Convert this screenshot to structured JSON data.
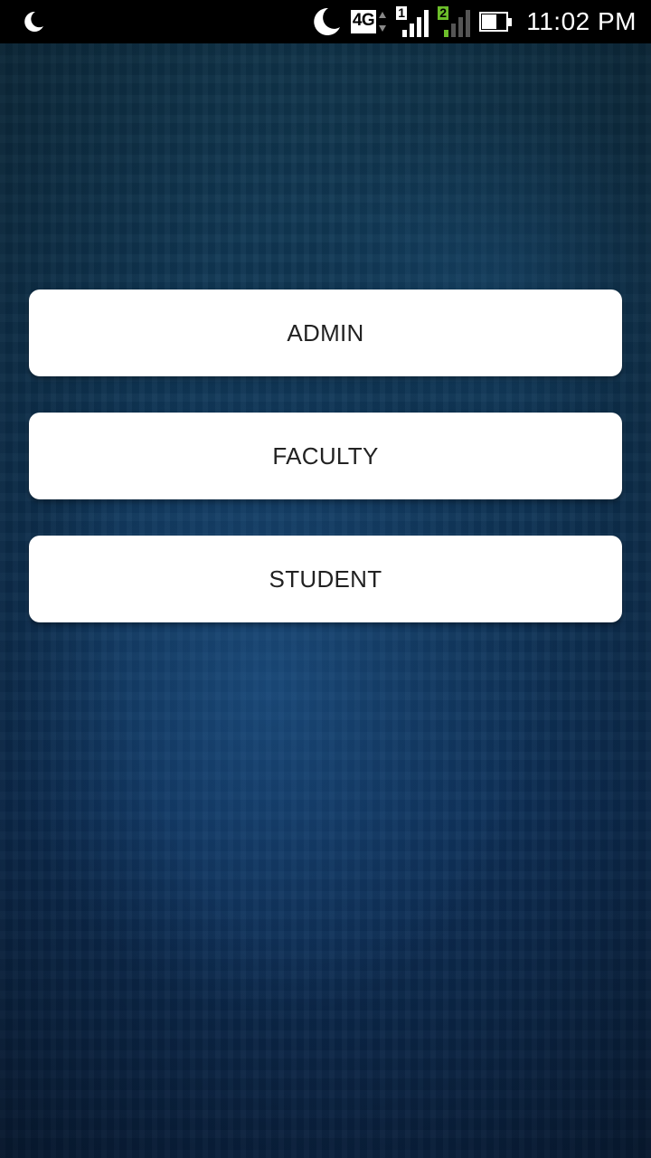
{
  "status_bar": {
    "network_type": "4G",
    "sim1_label": "1",
    "sim2_label": "2",
    "battery_level": 0.6,
    "time": "11:02 PM",
    "colors": {
      "sim2_accent": "#6cbe2a",
      "background": "#000000"
    },
    "icons": [
      "moon-icon",
      "dnd-moon-icon",
      "network-4g-icon",
      "signal-sim1-icon",
      "signal-sim2-icon",
      "battery-icon"
    ]
  },
  "roles": {
    "admin_label": "ADMIN",
    "faculty_label": "FACULTY",
    "student_label": "STUDENT"
  },
  "theme": {
    "background": "#0f3050",
    "button_background": "#ffffff",
    "button_text": "#222222"
  }
}
